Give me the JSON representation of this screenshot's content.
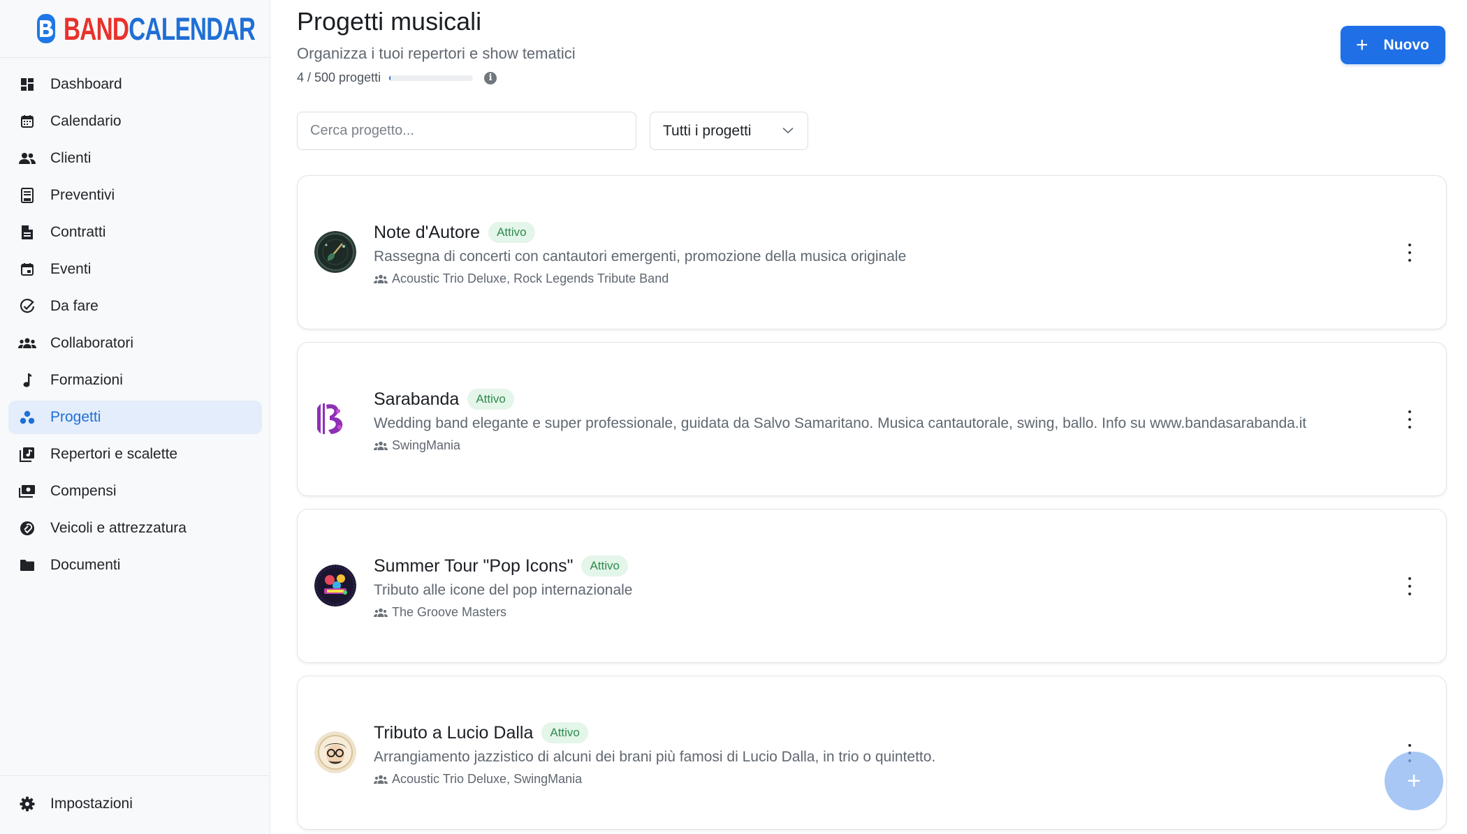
{
  "brand": {
    "part1": "BAND",
    "part2": "CALENDAR",
    "color1": "#e8322b",
    "color2": "#1f6fd6"
  },
  "sidebar": {
    "items": [
      {
        "label": "Dashboard",
        "icon": "dashboard-icon"
      },
      {
        "label": "Calendario",
        "icon": "calendar-icon"
      },
      {
        "label": "Clienti",
        "icon": "clients-icon"
      },
      {
        "label": "Preventivi",
        "icon": "quotes-icon"
      },
      {
        "label": "Contratti",
        "icon": "contracts-icon"
      },
      {
        "label": "Eventi",
        "icon": "events-icon"
      },
      {
        "label": "Da fare",
        "icon": "todo-icon"
      },
      {
        "label": "Collaboratori",
        "icon": "collaborators-icon"
      },
      {
        "label": "Formazioni",
        "icon": "music-note-icon"
      },
      {
        "label": "Progetti",
        "icon": "projects-icon",
        "active": true
      },
      {
        "label": "Repertori e scalette",
        "icon": "repertoire-icon"
      },
      {
        "label": "Compensi",
        "icon": "payments-icon"
      },
      {
        "label": "Veicoli e attrezzatura",
        "icon": "vehicles-icon"
      },
      {
        "label": "Documenti",
        "icon": "folder-icon"
      }
    ],
    "settings_label": "Impostazioni"
  },
  "header": {
    "title": "Progetti musicali",
    "subtitle": "Organizza i tuoi repertori e show tematici",
    "quota_text": "4 / 500 progetti",
    "quota_fraction": 0.008,
    "new_button_label": "Nuovo"
  },
  "filters": {
    "search_placeholder": "Cerca progetto...",
    "select_value": "Tutti i progetti"
  },
  "projects": [
    {
      "title": "Note d'Autore",
      "status": "Attivo",
      "description": "Rassegna di concerti con cantautori emergenti, promozione della musica originale",
      "bands": "Acoustic Trio Deluxe, Rock Legends Tribute Band"
    },
    {
      "title": "Sarabanda",
      "status": "Attivo",
      "description": "Wedding band elegante e super professionale, guidata da Salvo Samaritano. Musica cantautorale, swing, ballo. Info su www.bandasarabanda.it",
      "bands": "SwingMania"
    },
    {
      "title": "Summer Tour \"Pop Icons\"",
      "status": "Attivo",
      "description": "Tributo alle icone del pop internazionale",
      "bands": "The Groove Masters"
    },
    {
      "title": "Tributo a Lucio Dalla",
      "status": "Attivo",
      "description": "Arrangiamento jazzistico di alcuni dei brani più famosi di Lucio Dalla, in trio o quintetto.",
      "bands": "Acoustic Trio Deluxe, SwingMania"
    }
  ],
  "colors": {
    "accent": "#1f6fe6",
    "active_bg": "#e3edfb",
    "badge_bg": "#e4f5e9",
    "badge_text": "#2e8b4e"
  }
}
